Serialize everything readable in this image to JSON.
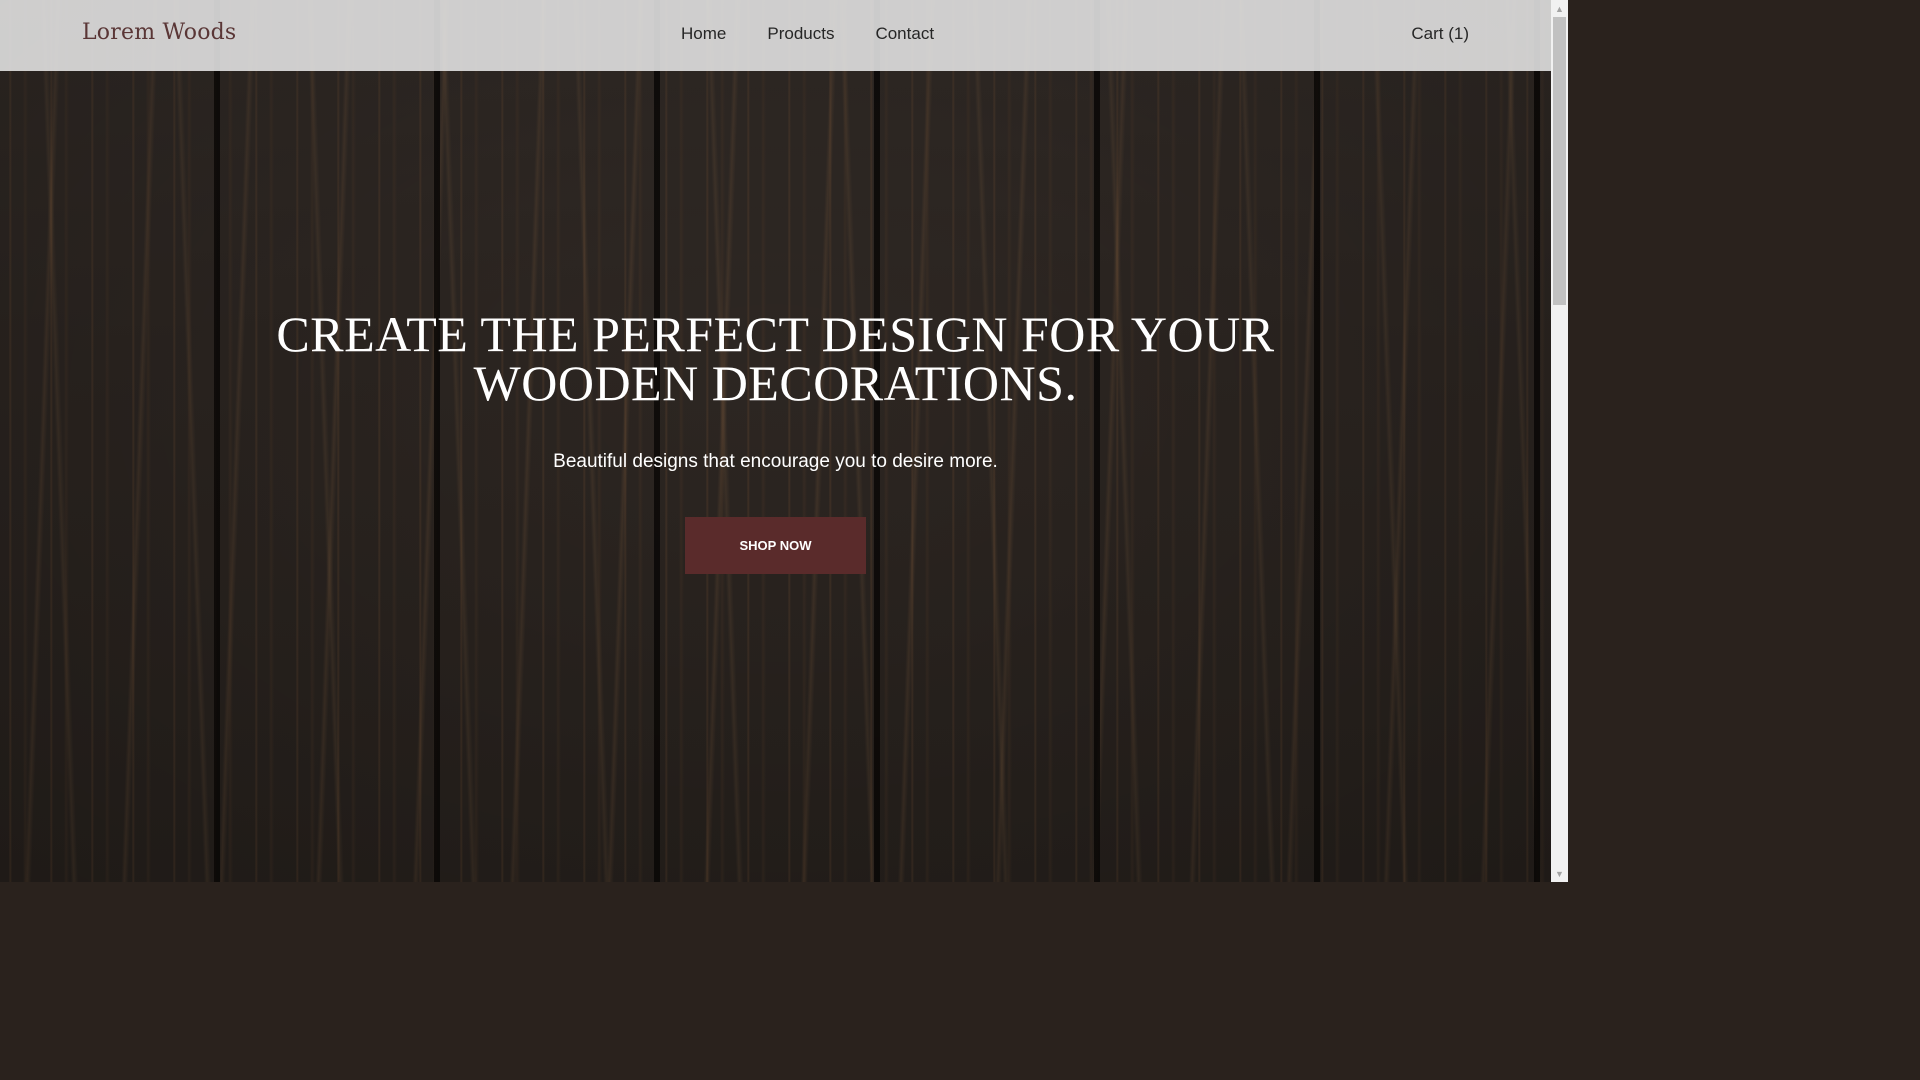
{
  "brand": {
    "name": "Lorem Woods"
  },
  "nav": {
    "items": [
      {
        "label": "Home"
      },
      {
        "label": "Products"
      },
      {
        "label": "Contact"
      }
    ],
    "cart_label": "Cart (1)"
  },
  "hero": {
    "title_line1": "CREATE THE PERFECT DESIGN FOR YOUR",
    "title_line2": "WOODEN DECORATIONS.",
    "subtitle": "Beautiful designs that encourage you to desire more.",
    "cta_label": "SHOP NOW"
  },
  "scrollbar": {
    "up_icon": "▲",
    "down_icon": "▼"
  },
  "colors": {
    "brand": "#5a3636",
    "cta": "#5a2b2b",
    "navbar": "#e6e6e6"
  }
}
